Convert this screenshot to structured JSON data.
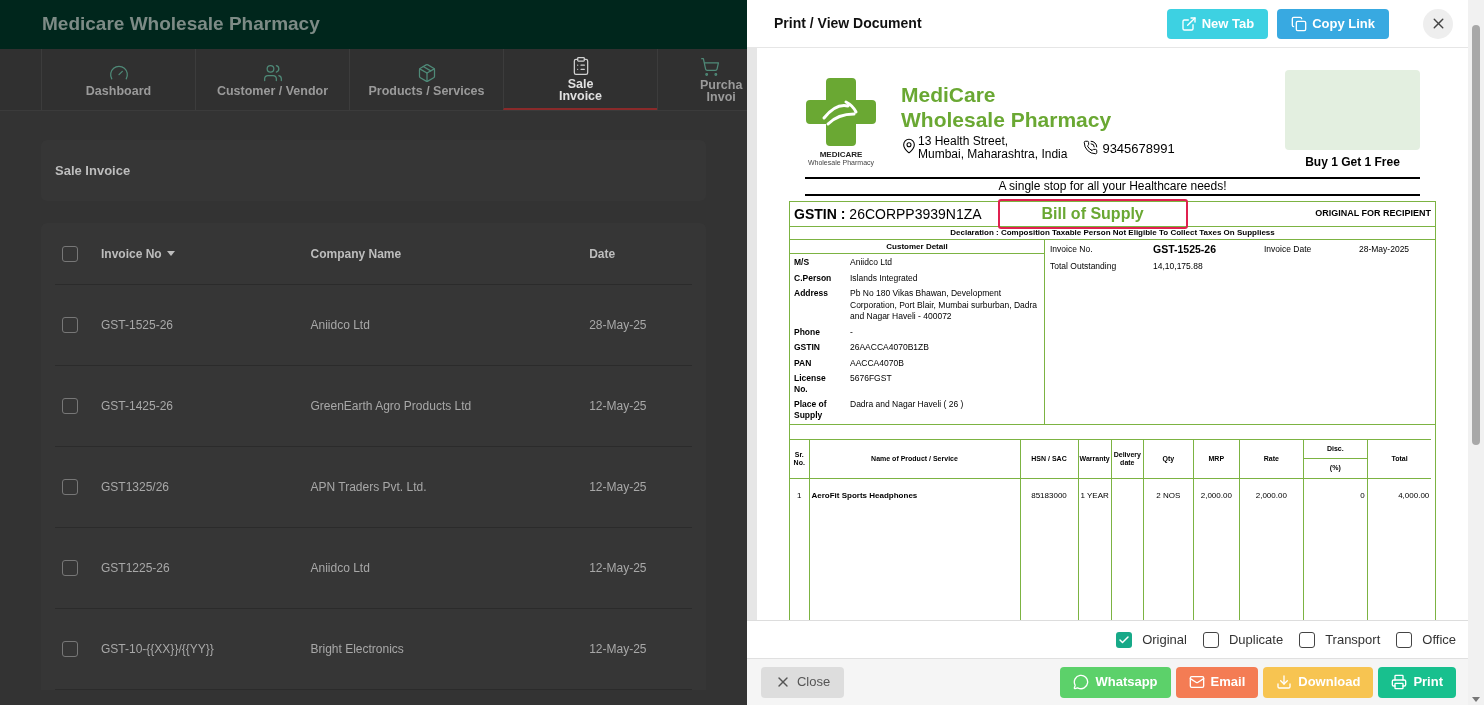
{
  "app": {
    "title": "Medicare Wholesale Pharmacy",
    "nav": [
      {
        "label": "Dashboard",
        "selected": false
      },
      {
        "label": "Customer / Vendor",
        "selected": false
      },
      {
        "label": "Products / Services",
        "selected": false
      },
      {
        "label": "Sale\nInvoice",
        "selected": true
      },
      {
        "label": "Purcha\nInvoi",
        "selected": false
      }
    ],
    "section_title": "Sale Invoice",
    "table": {
      "select_all_checked": false,
      "columns": [
        {
          "label": "Invoice No",
          "sorted": true
        },
        {
          "label": "Company Name",
          "sorted": false
        },
        {
          "label": "Date",
          "sorted": false
        }
      ],
      "rows": [
        {
          "invoice": "GST-1525-26",
          "company": "Aniidco Ltd",
          "date": "28-May-25",
          "checked": false
        },
        {
          "invoice": "GST-1425-26",
          "company": "GreenEarth Agro Products Ltd",
          "date": "12-May-25",
          "checked": false
        },
        {
          "invoice": "GST1325/26",
          "company": "APN Traders Pvt. Ltd.",
          "date": "12-May-25",
          "checked": false
        },
        {
          "invoice": "GST1225-26",
          "company": "Aniidco Ltd",
          "date": "12-May-25",
          "checked": false
        },
        {
          "invoice": "GST-10-{{XX}}/{{YY}}",
          "company": "Bright Electronics",
          "date": "12-May-25",
          "checked": false
        }
      ]
    }
  },
  "dialog": {
    "title": "Print / View Document",
    "header_buttons": [
      {
        "label": "New Tab",
        "kind": "new_tab"
      },
      {
        "label": "Copy Link",
        "kind": "copy_link"
      }
    ],
    "document": {
      "company_lines": [
        "MediCare",
        "Wholesale Pharmacy"
      ],
      "logo_caption": "MEDICARE",
      "logo_subcaption": "Wholesale Pharmacy",
      "address_lines": [
        "13 Health Street,",
        "Mumbai, Maharashtra, India"
      ],
      "phone": "9345678991",
      "promo": "Buy 1 Get 1 Free",
      "tagline": "A single stop for all your Healthcare needs!",
      "gstin_label": "GSTIN :",
      "gstin": "26CORPP3939N1ZA",
      "doc_type": "Bill of Supply",
      "copy_label": "ORIGINAL FOR RECIPIENT",
      "declaration": "Declaration : Composition Taxable Person Not Eligible To Collect Taxes On Suppliess",
      "customer_heading": "Customer Detail",
      "customer_fields": [
        {
          "label": "M/S",
          "value": "Aniidco Ltd"
        },
        {
          "label": "C.Person",
          "value": "Islands Integrated"
        },
        {
          "label": "Address",
          "value": "Pb No 180 Vikas Bhawan, Development Corporation, Port Blair, Mumbai surburban, Dadra and Nagar Haveli - 400072"
        },
        {
          "label": "Phone",
          "value": "-"
        },
        {
          "label": "GSTIN",
          "value": "26AACCA4070B1ZB"
        },
        {
          "label": "PAN",
          "value": "AACCA4070B"
        },
        {
          "label": "License No.",
          "value": "5676FGST"
        },
        {
          "label": "Place of Supply",
          "value": "Dadra and Nagar Haveli ( 26 )"
        }
      ],
      "invoice_fields": [
        {
          "label": "Invoice No.",
          "value": "GST-1525-26",
          "strong": true
        },
        {
          "label": "Invoice Date",
          "value": "28-May-2025",
          "strong": false
        },
        {
          "label": "Total Outstanding",
          "value": "14,10,175.88",
          "strong": false
        }
      ],
      "item_columns": [
        {
          "label": "Sr. No."
        },
        {
          "label": "Name of Product / Service"
        },
        {
          "label": "HSN / SAC"
        },
        {
          "label": "Warranty"
        },
        {
          "label": "Delivery date"
        },
        {
          "label": "Qty"
        },
        {
          "label": "MRP"
        },
        {
          "label": "Rate"
        },
        {
          "label": "Disc.",
          "sublabel": "(%)"
        },
        {
          "label": "Total"
        }
      ],
      "items": [
        {
          "sr": "1",
          "name": "AeroFit Sports Headphones",
          "hsn": "85183000",
          "warranty": "1 YEAR",
          "qty": "2 NOS",
          "mrp": "2,000.00",
          "rate": "2,000.00",
          "disc": "0",
          "total": "4,000.00"
        }
      ]
    },
    "copies": [
      {
        "label": "Original",
        "checked": true
      },
      {
        "label": "Duplicate",
        "checked": false
      },
      {
        "label": "Transport",
        "checked": false
      },
      {
        "label": "Office",
        "checked": false
      }
    ],
    "close_label": "Close",
    "actions": [
      {
        "label": "Whatsapp",
        "kind": "whatsapp"
      },
      {
        "label": "Email",
        "kind": "email"
      },
      {
        "label": "Download",
        "kind": "download"
      },
      {
        "label": "Print",
        "kind": "print"
      }
    ]
  }
}
